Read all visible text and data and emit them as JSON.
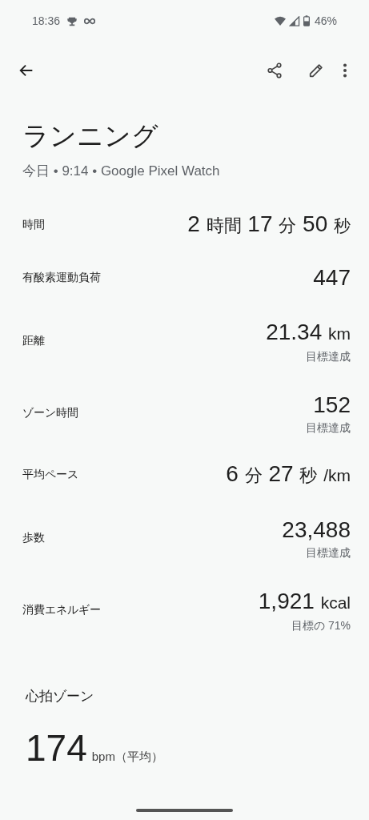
{
  "status_bar": {
    "time": "18:36",
    "battery": "46%"
  },
  "title": "ランニング",
  "subtitle": "今日 • 9:14 • Google Pixel Watch",
  "stats": [
    {
      "label": "時間",
      "value": [
        {
          "kind": "num",
          "text": "2"
        },
        {
          "kind": "unit",
          "text": "時間"
        },
        {
          "kind": "num",
          "text": "17"
        },
        {
          "kind": "unit",
          "text": "分"
        },
        {
          "kind": "num",
          "text": "50"
        },
        {
          "kind": "unit",
          "text": "秒"
        }
      ]
    },
    {
      "label": "有酸素運動負荷",
      "value": [
        {
          "kind": "num",
          "text": "447"
        }
      ]
    },
    {
      "label": "距離",
      "value": [
        {
          "kind": "num",
          "text": "21.34"
        },
        {
          "kind": "unit",
          "text": "km"
        }
      ],
      "note": "目標達成"
    },
    {
      "label": "ゾーン時間",
      "value": [
        {
          "kind": "num",
          "text": "152"
        }
      ],
      "note": "目標達成"
    },
    {
      "label": "平均ペース",
      "value": [
        {
          "kind": "num",
          "text": "6"
        },
        {
          "kind": "unit",
          "text": "分"
        },
        {
          "kind": "num",
          "text": "27"
        },
        {
          "kind": "unit",
          "text": "秒"
        },
        {
          "kind": "unit",
          "text": "/km"
        }
      ]
    },
    {
      "label": "歩数",
      "value": [
        {
          "kind": "num",
          "text": "23,488"
        }
      ],
      "note": "目標達成"
    },
    {
      "label": "消費エネルギー",
      "value": [
        {
          "kind": "num",
          "text": "1,921"
        },
        {
          "kind": "unit",
          "text": "kcal"
        }
      ],
      "note": "目標の 71%"
    }
  ],
  "heart": {
    "title": "心拍ゾーン",
    "value": "174",
    "unit": "bpm（平均）"
  }
}
